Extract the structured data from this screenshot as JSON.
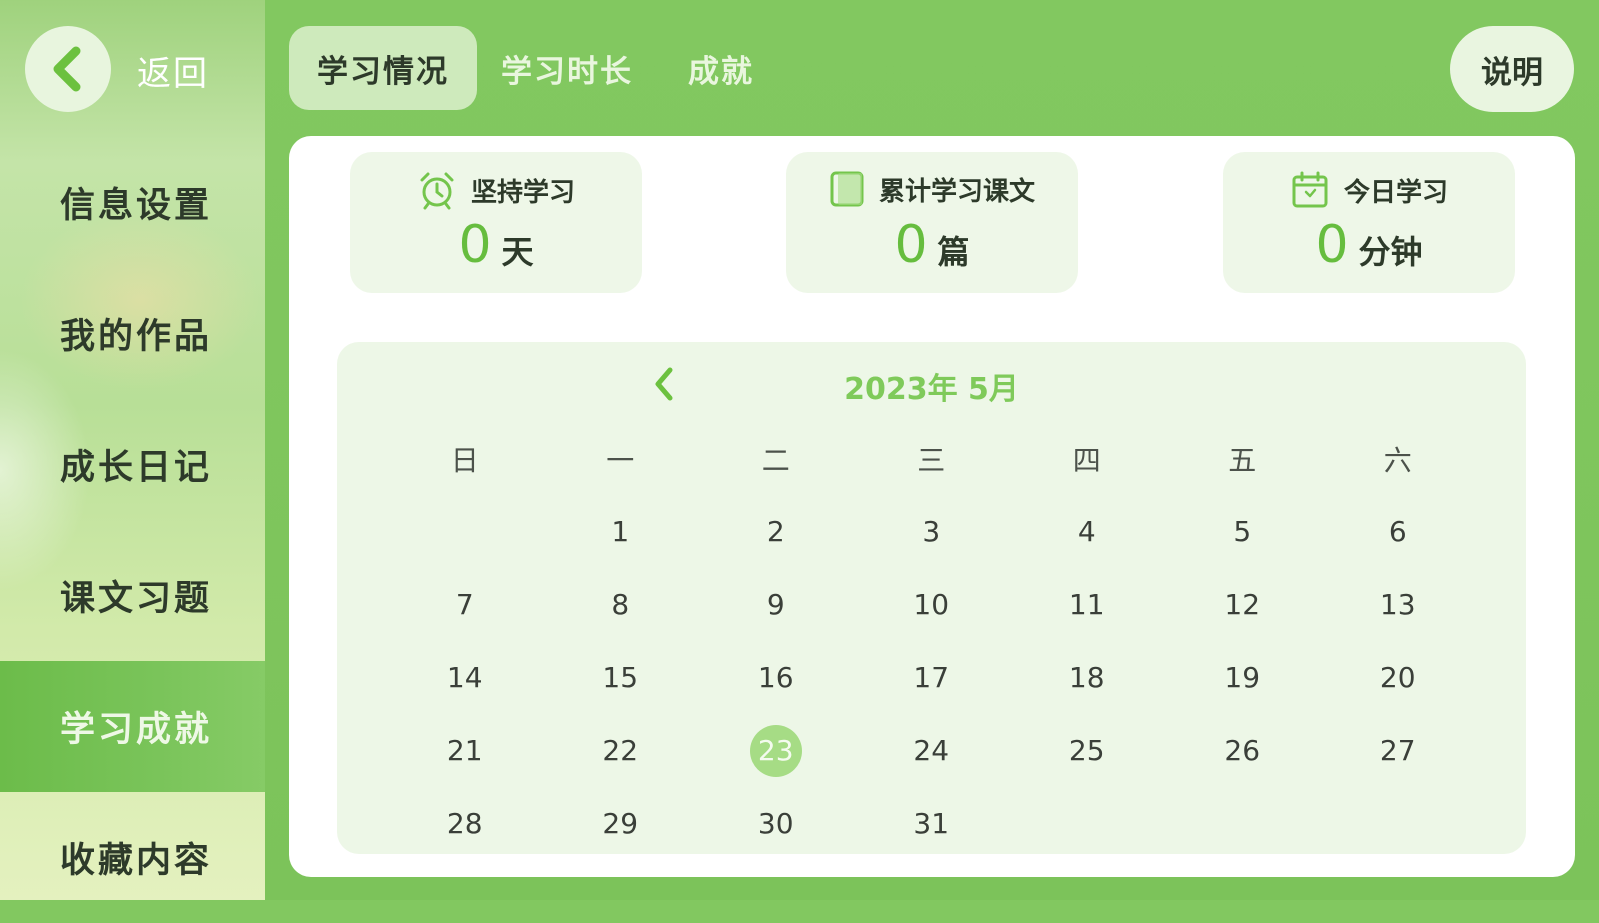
{
  "sidebar": {
    "back_label": "返回",
    "items": [
      {
        "label": "信息设置"
      },
      {
        "label": "我的作品"
      },
      {
        "label": "成长日记"
      },
      {
        "label": "课文习题"
      },
      {
        "label": "学习成就"
      },
      {
        "label": "收藏内容"
      }
    ],
    "active_index": 4
  },
  "tabs": [
    {
      "label": "学习情况"
    },
    {
      "label": "学习时长"
    },
    {
      "label": "成就"
    }
  ],
  "active_tab": 0,
  "help_label": "说明",
  "stats": [
    {
      "title": "坚持学习",
      "value": "0",
      "unit": "天",
      "icon": "alarm-clock-icon"
    },
    {
      "title": "累计学习课文",
      "value": "0",
      "unit": "篇",
      "icon": "book-icon"
    },
    {
      "title": "今日学习",
      "value": "0",
      "unit": "分钟",
      "icon": "calendar-icon"
    }
  ],
  "calendar": {
    "title": "2023年 5月",
    "weekdays": [
      "日",
      "一",
      "二",
      "三",
      "四",
      "五",
      "六"
    ],
    "weeks": [
      [
        "",
        "1",
        "2",
        "3",
        "4",
        "5",
        "6"
      ],
      [
        "7",
        "8",
        "9",
        "10",
        "11",
        "12",
        "13"
      ],
      [
        "14",
        "15",
        "16",
        "17",
        "18",
        "19",
        "20"
      ],
      [
        "21",
        "22",
        "23",
        "24",
        "25",
        "26",
        "27"
      ],
      [
        "28",
        "29",
        "30",
        "31",
        "",
        "",
        ""
      ]
    ],
    "today": "23"
  },
  "colors": {
    "accent": "#66bd3e",
    "today_bg": "#a6dc85",
    "panel_bg": "#ffffff",
    "card_bg": "#eef7e8"
  }
}
